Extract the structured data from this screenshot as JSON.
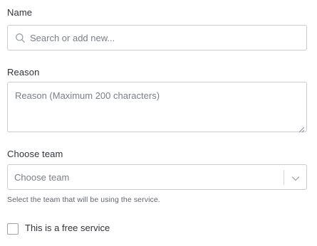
{
  "name": {
    "label": "Name",
    "placeholder": "Search or add new...",
    "icon": "search-icon"
  },
  "reason": {
    "label": "Reason",
    "placeholder": "Reason (Maximum 200 characters)"
  },
  "team": {
    "label": "Choose team",
    "placeholder": "Choose team",
    "icon": "chevron-down-icon",
    "helper": "Select the team that will be using the service."
  },
  "free_service": {
    "label": "This is a free service",
    "checked": false
  },
  "colors": {
    "border": "#c9ccd1",
    "placeholder": "#7a7f87",
    "label": "#2f333a"
  }
}
